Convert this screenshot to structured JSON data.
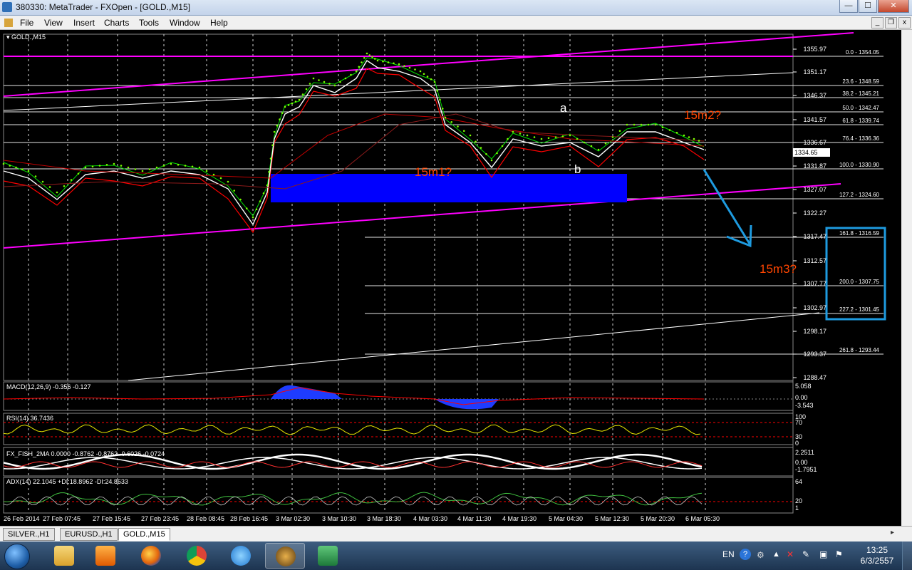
{
  "window": {
    "title": "380330: MetaTrader - FXOpen - [GOLD.,M15]",
    "minimize": "—",
    "maximize": "☐",
    "close": "✕"
  },
  "menu": {
    "items": [
      "File",
      "View",
      "Insert",
      "Charts",
      "Tools",
      "Window",
      "Help"
    ]
  },
  "mdi": {
    "minimize": "_",
    "restore": "❐",
    "close": "x"
  },
  "chart": {
    "symbol_label": "GOLD.,M15",
    "bid_price": "1334.65",
    "price_axis": [
      "1355.97",
      "1351.17",
      "1346.37",
      "1341.57",
      "1336.67",
      "1331.87",
      "1327.07",
      "1322.27",
      "1317.47",
      "1312.57",
      "1307.77",
      "1302.97",
      "1298.17",
      "1293.37",
      "1288.47"
    ],
    "fib_levels": [
      "0.0 - 1354.05",
      "23.6 - 1348.59",
      "38.2 - 1345.21",
      "50.0 - 1342.47",
      "61.8 - 1339.74",
      "76.4 - 1336.36",
      "100.0 - 1330.90",
      "127.2 - 1324.60",
      "161.8 - 1316.59",
      "200.0 - 1307.75",
      "227.2 - 1301.45",
      "261.8 - 1293.44"
    ],
    "annotations": {
      "a": "a",
      "b": "b",
      "m1": "15m1?",
      "m2": "15m2?",
      "m3": "15m3?"
    },
    "time_axis": [
      "26 Feb 2014",
      "27 Feb 07:45",
      "27 Feb 15:45",
      "27 Feb 23:45",
      "28 Feb 08:45",
      "28 Feb 16:45",
      "3 Mar 02:30",
      "3 Mar 10:30",
      "3 Mar 18:30",
      "4 Mar 03:30",
      "4 Mar 11:30",
      "4 Mar 19:30",
      "5 Mar 04:30",
      "5 Mar 12:30",
      "5 Mar 20:30",
      "6 Mar 05:30"
    ]
  },
  "indicators": {
    "macd": {
      "label": "MACD(12,26,9) -0.356 -0.127",
      "axis": [
        "5.058",
        "0.00",
        "-3.543"
      ]
    },
    "rsi": {
      "label": "RSI(14) 36.7436",
      "axis": [
        "100",
        "70",
        "30",
        "0"
      ]
    },
    "fish": {
      "label": "FX_FISH_2MA 0.0000 -0.8762 -0.8762 -0.6026 -0.0724",
      "axis": [
        "2.2511",
        "0.00",
        "-1.7951"
      ]
    },
    "adx": {
      "label": "ADX(14) 22.1045 +DI:18.8962 -DI:24.8633",
      "axis": [
        "64",
        "20",
        "1"
      ]
    }
  },
  "tabs": [
    "SILVER.,H1",
    "EURUSD.,H1",
    "GOLD.,M15"
  ],
  "active_tab": "GOLD.,M15",
  "taskbar": {
    "lang": "EN",
    "time": "13:25",
    "date": "6/3/2557"
  },
  "colors": {
    "candle_up": "#00ff00",
    "candle_down": "#ff0000",
    "channel": "#ff00ff",
    "zone": "#0000ff",
    "projection": "#1e9be0",
    "annotation": "#ff4500"
  }
}
